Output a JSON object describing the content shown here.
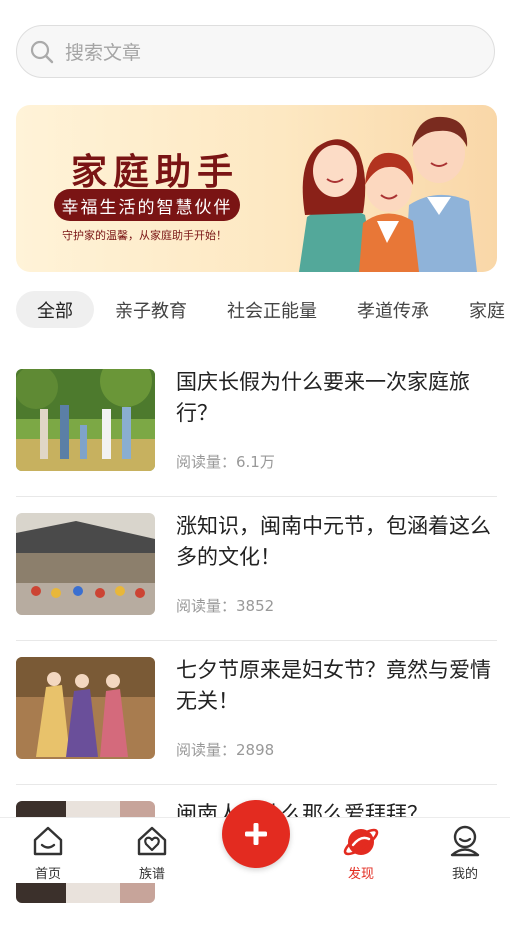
{
  "search": {
    "placeholder": "搜索文章"
  },
  "banner": {
    "title": "家庭助手",
    "tagline": "幸福生活的智慧伙伴",
    "subtitle": "守护家的温馨，从家庭助手开始！"
  },
  "categories": [
    {
      "label": "全部",
      "active": true
    },
    {
      "label": "亲子教育",
      "active": false
    },
    {
      "label": "社会正能量",
      "active": false
    },
    {
      "label": "孝道传承",
      "active": false
    },
    {
      "label": "家庭",
      "active": false
    }
  ],
  "articles": [
    {
      "title": "国庆长假为什么要来一次家庭旅行？",
      "reads": "阅读量：6.1万"
    },
    {
      "title": "涨知识，闽南中元节，包涵着这么多的文化！",
      "reads": "阅读量：3852"
    },
    {
      "title": "七夕节原来是妇女节？竟然与爱情无关！",
      "reads": "阅读量：2898"
    },
    {
      "title": "闽南人为什么那么爱拜拜？",
      "reads": ""
    }
  ],
  "tabbar": {
    "items": [
      {
        "label": "首页",
        "icon": "home-icon"
      },
      {
        "label": "族谱",
        "icon": "family-tree-icon"
      },
      {
        "label": "发现",
        "icon": "discover-icon",
        "active": true
      },
      {
        "label": "我的",
        "icon": "profile-icon"
      }
    ],
    "center_action": "plus-icon"
  },
  "colors": {
    "accent": "#e32b20",
    "banner_text": "#7a1414"
  }
}
